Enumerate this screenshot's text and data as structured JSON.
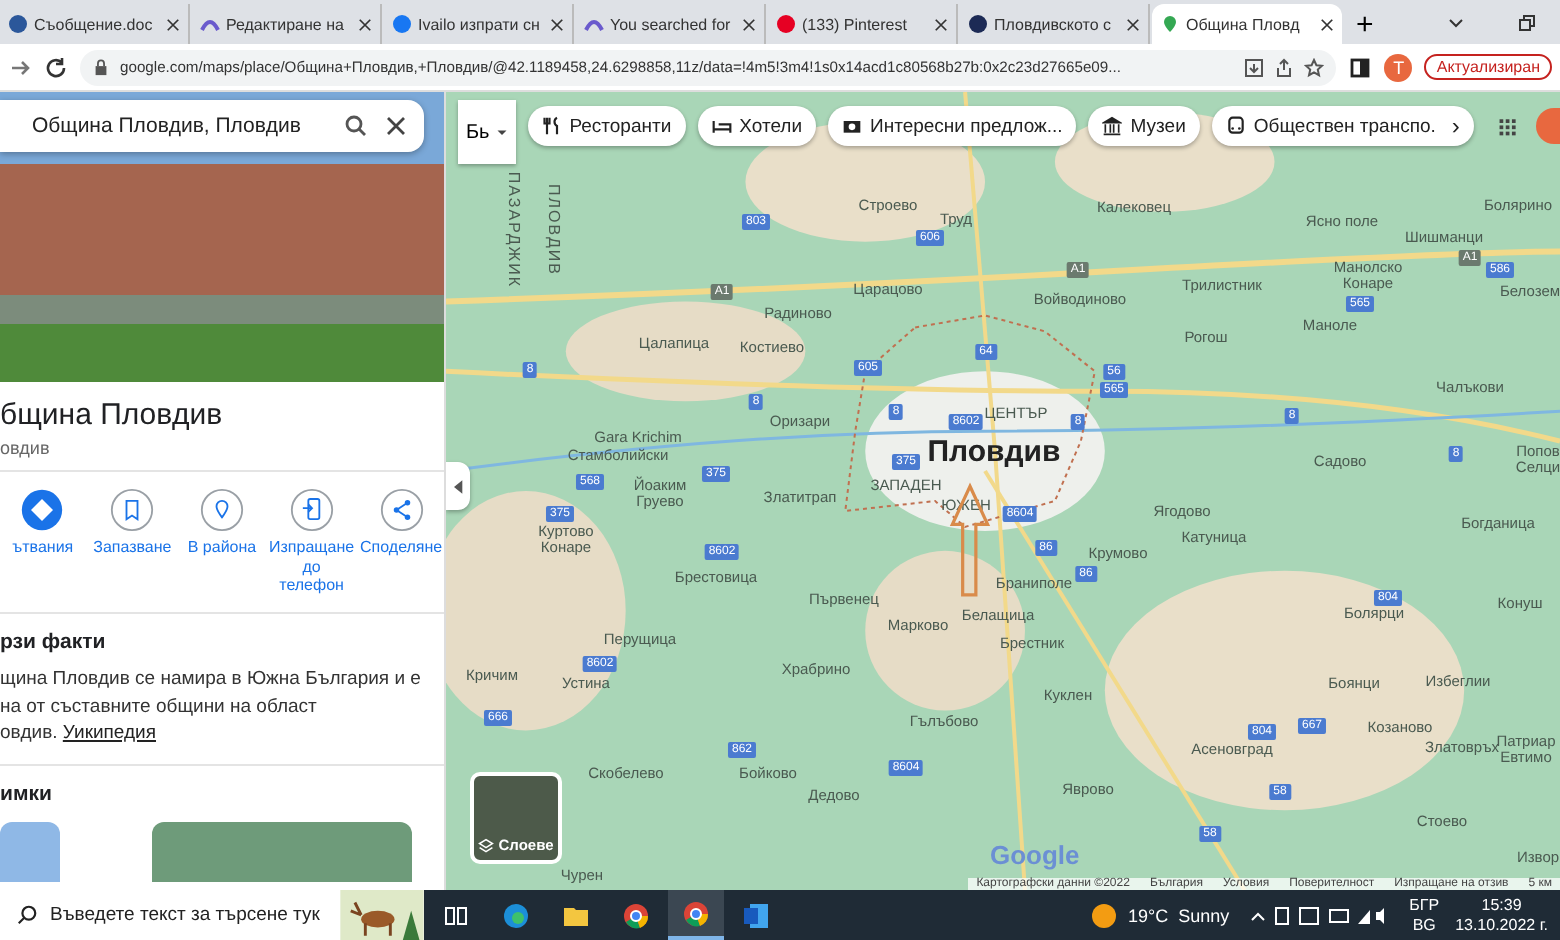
{
  "browser": {
    "tabs": [
      {
        "label": "Съобщение.doc",
        "kind": "doc",
        "selected": false
      },
      {
        "label": "Редактиране на",
        "kind": "arc",
        "selected": false
      },
      {
        "label": "Ivailo изпрати сн",
        "kind": "facebook",
        "selected": false
      },
      {
        "label": "You searched for",
        "kind": "arc",
        "selected": false
      },
      {
        "label": "(133) Pinterest",
        "kind": "pinterest",
        "selected": false
      },
      {
        "label": "Пловдивското с",
        "kind": "m",
        "selected": false
      },
      {
        "label": "Община Пловд",
        "kind": "pin",
        "selected": true
      }
    ],
    "new_tab": "+",
    "url": "google.com/maps/place/Община+Пловдив,+Пловдив/@42.1189458,24.6298858,11z/data=!4m5!3m4!1s0x14acd1c80568b27b:0x2c23d27665e09...",
    "profile": "T",
    "update_button": "Актуализиран"
  },
  "panel": {
    "search_value": "Община Пловдив, Пловдив",
    "title": "бщина Пловдив",
    "subtitle": "овдив",
    "actions": [
      {
        "label": "ътвания",
        "kind": "directions"
      },
      {
        "label": "Запазване",
        "kind": "save"
      },
      {
        "label": "В района",
        "kind": "nearby"
      },
      {
        "label": "Изпращане\nдо телефон",
        "kind": "phone"
      },
      {
        "label": "Споделяне",
        "kind": "share"
      }
    ],
    "facts_heading": "рзи факти",
    "facts_lines": [
      "щина Пловдив се намира в Южна България и е",
      "на от съставните общини на област"
    ],
    "facts_last": "овдив.",
    "facts_link": "Уикипедия",
    "photos_heading": "имки"
  },
  "map": {
    "input_tool": "Бь",
    "chips": [
      {
        "label": "Ресторанти",
        "kind": "food"
      },
      {
        "label": "Хотели",
        "kind": "bed"
      },
      {
        "label": "Интересни предлож...",
        "kind": "camera"
      },
      {
        "label": "Музеи",
        "kind": "museum"
      },
      {
        "label": "Обществен транспо.",
        "kind": "bus"
      }
    ],
    "chips_more": "›",
    "city": "Пловдив",
    "towns": [
      "ПАЗАРДЖИК",
      "ПЛОВДИВ",
      "Строево",
      "Труд",
      "Калековец",
      "Ясно поле",
      "Болярино",
      "Шишманци",
      "Царацово",
      "Войводиново",
      "Трилистник",
      "Манолско\nКонаре",
      "Белозем",
      "Радиново",
      "Цалапица",
      "Костиево",
      "Рогош",
      "Маноле",
      "Чалъкови",
      "Оризари",
      "ЦЕНТЪР",
      "Gara Krichim",
      "Стамболийски",
      "Садово",
      "Попов\nСелци",
      "Йоаким\nГруево",
      "ЗАПАДЕН",
      "Златитрап",
      "ЮЖЕН",
      "Ягодово",
      "Катуница",
      "Богданица",
      "Куртово\nКонаре",
      "Крумово",
      "Брестовица",
      "Първенец",
      "Браниполе",
      "Белащица",
      "Конуш",
      "Болярци",
      "Марково",
      "Брестник",
      "Перущица",
      "Кричим",
      "Устина",
      "Храбрино",
      "Боянци",
      "Избеглии",
      "Куклен",
      "Гълъбово",
      "Козаново",
      "Асеновград",
      "Златовръх",
      "Патриар\nЕвтимо",
      "Скобелево",
      "Бойково",
      "Дедово",
      "Яврово",
      "Стоево",
      "Извор",
      "Чурен"
    ],
    "roads": [
      "803",
      "606",
      "A1",
      "A1",
      "A1",
      "565",
      "586",
      "8",
      "8",
      "8",
      "8",
      "8",
      "8",
      "64",
      "605",
      "56",
      "565",
      "8602",
      "375",
      "375",
      "568",
      "375",
      "8604",
      "86",
      "86",
      "8602",
      "804",
      "8602",
      "666",
      "862",
      "8604",
      "804",
      "667",
      "58",
      "58"
    ],
    "layers": "Слоеве",
    "logo": "Google",
    "attribution": [
      "Картографски данни ©2022",
      "България",
      "Условия",
      "Поверителност",
      "Изпращане на отзив",
      "5 км"
    ]
  },
  "taskbar": {
    "search_placeholder": "Въведете текст за търсене тук",
    "apps": [
      {
        "kind": "taskview",
        "selected": false
      },
      {
        "kind": "edge",
        "selected": false
      },
      {
        "kind": "files",
        "selected": false
      },
      {
        "kind": "chrome",
        "selected": false
      },
      {
        "kind": "chrome",
        "selected": true
      },
      {
        "kind": "word",
        "selected": false
      }
    ],
    "weather": "19°C  Sunny",
    "lang_top": "БГР",
    "lang_bottom": "BG",
    "time": "15:39",
    "date": "13.10.2022 г."
  }
}
